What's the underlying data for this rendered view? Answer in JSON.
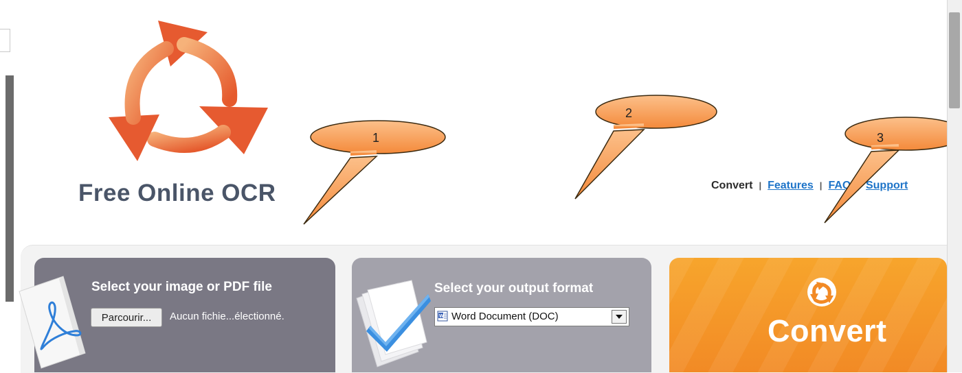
{
  "site": {
    "brand": "Free Online OCR"
  },
  "nav": {
    "current": "Convert",
    "separator": "|",
    "links": [
      "Features",
      "FAQ",
      "Support"
    ]
  },
  "steps": {
    "select_file": {
      "title": "Select your image or PDF file",
      "browse_label": "Parcourir...",
      "file_status": "Aucun fichie...électionné."
    },
    "output_format": {
      "title": "Select your output format",
      "selected": "Word Document (DOC)"
    },
    "convert": {
      "label": "Convert"
    }
  },
  "callouts": [
    "1",
    "2",
    "3"
  ],
  "colors": {
    "brand_text": "#4a5568",
    "link": "#1e74c8",
    "panel_dark": "#7a7884",
    "panel_light": "#a3a2ab",
    "convert_orange": "#f7a52c",
    "callout": "#f9a25a",
    "logo_orange": "#e8552f"
  },
  "icons": {
    "logo": "recycle-arrows-icon",
    "file": "pdf-file-icon",
    "format": "documents-checkmark-icon",
    "convert": "convert-cycle-icon",
    "select_item": "word-doc-icon"
  }
}
